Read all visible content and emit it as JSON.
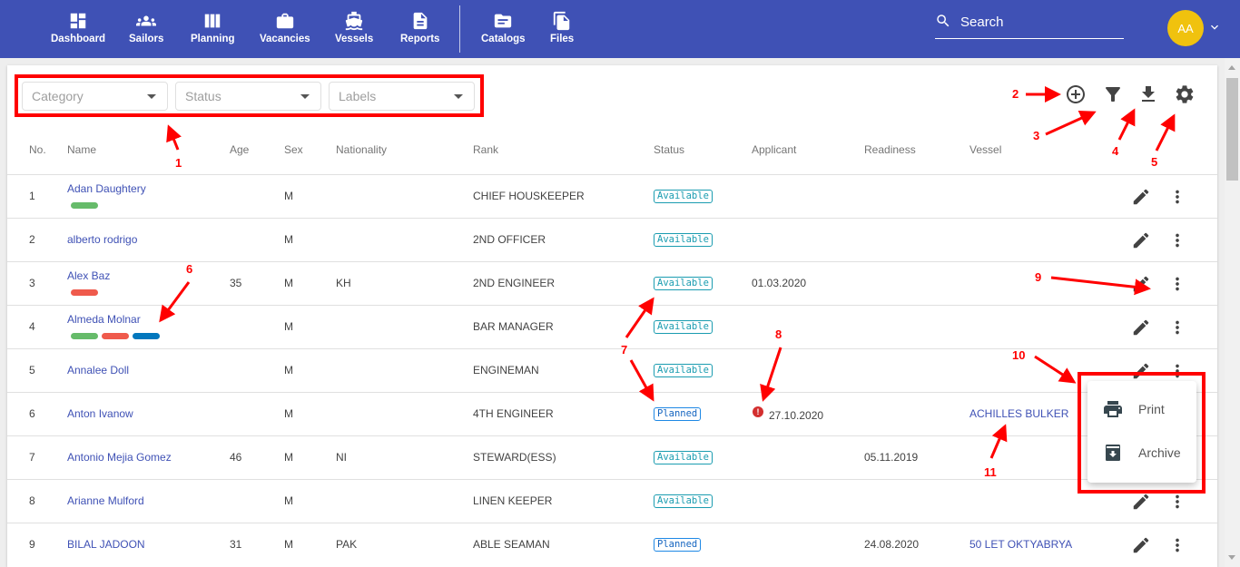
{
  "nav": {
    "items": [
      {
        "label": "Dashboard",
        "icon": "dashboard-icon"
      },
      {
        "label": "Sailors",
        "icon": "sailors-icon"
      },
      {
        "label": "Planning",
        "icon": "planning-icon"
      },
      {
        "label": "Vacancies",
        "icon": "vacancies-icon"
      },
      {
        "label": "Vessels",
        "icon": "vessels-icon"
      },
      {
        "label": "Reports",
        "icon": "reports-icon"
      },
      {
        "label": "Catalogs",
        "icon": "catalogs-icon"
      },
      {
        "label": "Files",
        "icon": "files-icon"
      }
    ],
    "search_placeholder": "Search",
    "avatar_initials": "AA"
  },
  "filters": {
    "category_placeholder": "Category",
    "status_placeholder": "Status",
    "labels_placeholder": "Labels"
  },
  "toolbar": [
    "add-icon",
    "filter-icon",
    "download-icon",
    "settings-icon"
  ],
  "table": {
    "columns": [
      "No.",
      "Name",
      "Age",
      "Sex",
      "Nationality",
      "Rank",
      "Status",
      "Applicant",
      "Readiness",
      "Vessel"
    ],
    "rows": [
      {
        "no": "1",
        "name": "Adan Daughtery",
        "labels": [
          "#66bb6a"
        ],
        "age": "",
        "sex": "M",
        "nationality": "",
        "rank": "CHIEF HOUSKEEPER",
        "status": "Available",
        "applicant": "",
        "applicant_warning": false,
        "readiness": "",
        "vessel": ""
      },
      {
        "no": "2",
        "name": "alberto rodrigo",
        "labels": [],
        "age": "",
        "sex": "M",
        "nationality": "",
        "rank": "2ND OFFICER",
        "status": "Available",
        "applicant": "",
        "applicant_warning": false,
        "readiness": "",
        "vessel": ""
      },
      {
        "no": "3",
        "name": "Alex Baz",
        "labels": [
          "#ef5a4c"
        ],
        "age": "35",
        "sex": "M",
        "nationality": "KH",
        "rank": "2ND ENGINEER",
        "status": "Available",
        "applicant": "01.03.2020",
        "applicant_warning": false,
        "readiness": "",
        "vessel": ""
      },
      {
        "no": "4",
        "name": "Almeda Molnar",
        "labels": [
          "#66bb6a",
          "#ef5a4c",
          "#0277bd"
        ],
        "age": "",
        "sex": "M",
        "nationality": "",
        "rank": "BAR MANAGER",
        "status": "Available",
        "applicant": "",
        "applicant_warning": false,
        "readiness": "",
        "vessel": ""
      },
      {
        "no": "5",
        "name": "Annalee Doll",
        "labels": [],
        "age": "",
        "sex": "M",
        "nationality": "",
        "rank": "ENGINEMAN",
        "status": "Available",
        "applicant": "",
        "applicant_warning": false,
        "readiness": "",
        "vessel": ""
      },
      {
        "no": "6",
        "name": "Anton Ivanow",
        "labels": [],
        "age": "",
        "sex": "M",
        "nationality": "",
        "rank": "4TH ENGINEER",
        "status": "Planned",
        "applicant": "27.10.2020",
        "applicant_warning": true,
        "readiness": "",
        "vessel": "ACHILLES BULKER"
      },
      {
        "no": "7",
        "name": "Antonio Mejia Gomez",
        "labels": [],
        "age": "46",
        "sex": "M",
        "nationality": "NI",
        "rank": "STEWARD(ESS)",
        "status": "Available",
        "applicant": "",
        "applicant_warning": false,
        "readiness": "05.11.2019",
        "vessel": ""
      },
      {
        "no": "8",
        "name": "Arianne Mulford",
        "labels": [],
        "age": "",
        "sex": "M",
        "nationality": "",
        "rank": "LINEN KEEPER",
        "status": "Available",
        "applicant": "",
        "applicant_warning": false,
        "readiness": "",
        "vessel": ""
      },
      {
        "no": "9",
        "name": "BILAL JADOON",
        "labels": [],
        "age": "31",
        "sex": "M",
        "nationality": "PAK",
        "rank": "ABLE SEAMAN",
        "status": "Planned",
        "applicant": "",
        "applicant_warning": false,
        "readiness": "24.08.2020",
        "vessel": "50 LET OKTYABRYA"
      }
    ]
  },
  "context_menu": {
    "items": [
      {
        "label": "Print",
        "icon": "print-icon"
      },
      {
        "label": "Archive",
        "icon": "archive-icon"
      }
    ]
  },
  "annotations": [
    "1",
    "2",
    "3",
    "4",
    "5",
    "6",
    "7",
    "8",
    "9",
    "10",
    "11"
  ],
  "colors": {
    "primary": "#3f51b5",
    "avatar": "#f0c20e",
    "available": "#1a9cb0",
    "planned": "#1e88e5",
    "warning": "#d32f2f",
    "annotation": "#ff0000"
  }
}
